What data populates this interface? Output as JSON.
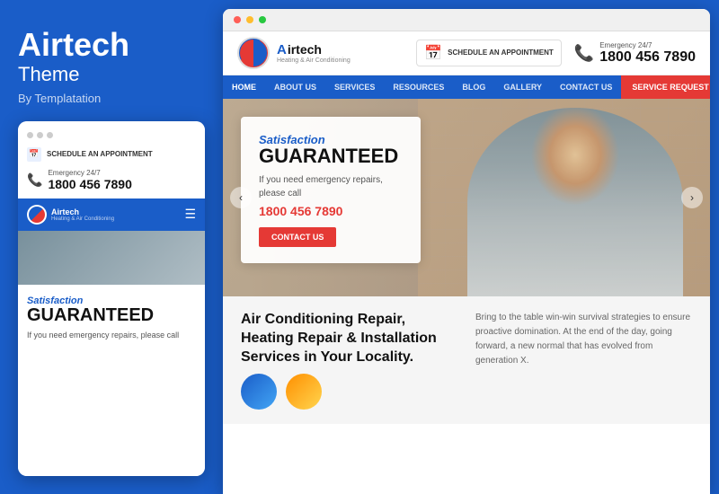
{
  "left": {
    "brand": {
      "title": "Airtech",
      "subtitle": "Theme",
      "by": "By Templatation"
    },
    "mobile": {
      "dots": [
        "dot1",
        "dot2",
        "dot3"
      ],
      "schedule_label": "SCHEDULE AN\nAPPOINTMENT",
      "emergency_label": "Emergency 24/7",
      "phone_number": "1800 456 7890",
      "logo_name": "Airtech",
      "logo_sub": "Heating & Air Conditioning",
      "satisfaction": "Satisfaction",
      "guaranteed": "GUARANTEED",
      "desc": "If you need\nemergency repairs,\nplease call"
    }
  },
  "browser": {
    "dots": [
      "red",
      "yellow",
      "green"
    ]
  },
  "website": {
    "header": {
      "logo_name": "Airtech",
      "logo_name_a": "A",
      "logo_sub": "Heating & Air Conditioning",
      "schedule_label": "SCHEDULE AN\nAPPOINTMENT",
      "emergency_label": "Emergency 24/7",
      "phone_number": "1800 456 7890"
    },
    "nav": {
      "items": [
        {
          "label": "HOME",
          "active": true
        },
        {
          "label": "ABOUT US",
          "active": false
        },
        {
          "label": "SERVICES",
          "active": false
        },
        {
          "label": "RESOURCES",
          "active": false
        },
        {
          "label": "BLOG",
          "active": false
        },
        {
          "label": "GALLERY",
          "active": false
        },
        {
          "label": "CONTACT US",
          "active": false
        }
      ],
      "service_request": "SERVICE REQUEST"
    },
    "hero": {
      "satisfaction": "Satisfaction",
      "guaranteed": "GUARANTEED",
      "desc": "If you need emergency\nrepairs, please call",
      "phone": "1800 456 7890",
      "contact_btn": "CONTACT US",
      "arrow_left": "‹",
      "arrow_right": "›"
    },
    "bottom": {
      "heading": "Air Conditioning Repair, Heating\nRepair & Installation\nServices in Your Locality.",
      "desc": "Bring to the table win-win survival strategies to\nensure proactive domination. At the end of the day,\ngoing forward, a new normal that has evolved from\ngeneration X."
    }
  }
}
